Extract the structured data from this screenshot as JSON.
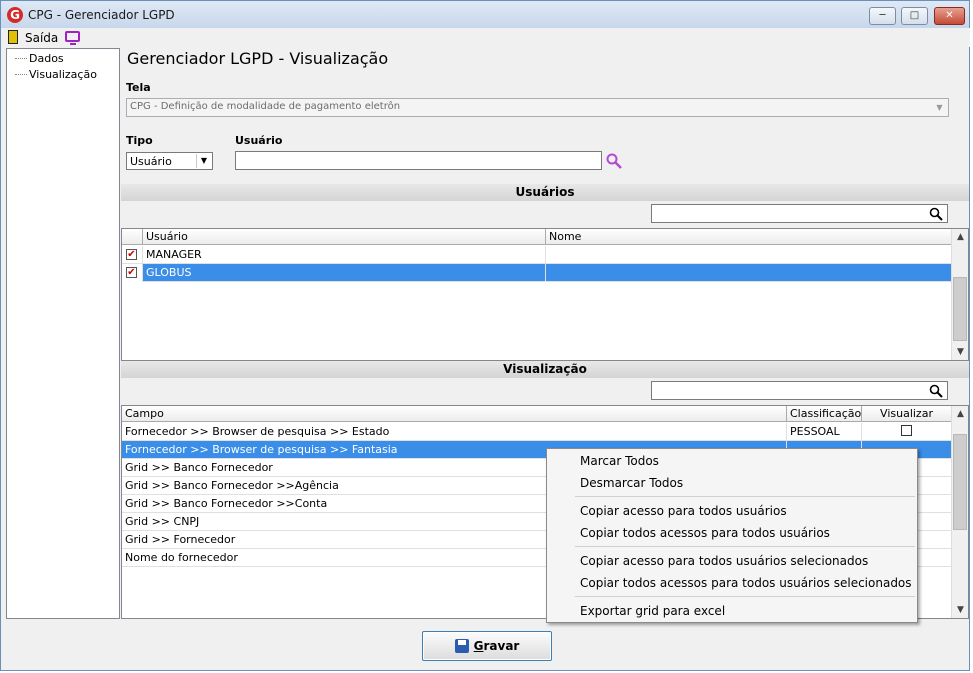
{
  "window": {
    "title": "CPG - Gerenciador LGPD"
  },
  "menubar": {
    "exit_label": "Saída"
  },
  "tree": {
    "items": [
      "Dados",
      "Visualização"
    ]
  },
  "main": {
    "title": "Gerenciador LGPD - Visualização",
    "tela_label": "Tela",
    "tela_value": "CPG - Definição de modalidade de pagamento eletrôn",
    "tipo_label": "Tipo",
    "tipo_value": "Usuário",
    "usuario_label": "Usuário",
    "usuario_value": ""
  },
  "users_section": {
    "title": "Usuários",
    "columns": [
      "Usuário",
      "Nome"
    ],
    "rows": [
      {
        "user": "MANAGER",
        "name": "",
        "checked": true
      },
      {
        "user": "GLOBUS",
        "name": "",
        "checked": true
      }
    ]
  },
  "view_section": {
    "title": "Visualização",
    "columns": [
      "Campo",
      "Classificação",
      "Visualizar"
    ],
    "rows": [
      {
        "campo": "Fornecedor >> Browser de pesquisa >> Estado",
        "classificacao": "PESSOAL",
        "visualizar": false
      },
      {
        "campo": "Fornecedor >> Browser de pesquisa >> Fantasia",
        "classificacao": "",
        "visualizar": false
      },
      {
        "campo": "Grid >> Banco Fornecedor",
        "classificacao": "",
        "visualizar": false
      },
      {
        "campo": "Grid >> Banco Fornecedor >>Agência",
        "classificacao": "",
        "visualizar": false
      },
      {
        "campo": "Grid >> Banco Fornecedor >>Conta",
        "classificacao": "",
        "visualizar": false
      },
      {
        "campo": "Grid >> CNPJ",
        "classificacao": "",
        "visualizar": false
      },
      {
        "campo": "Grid >> Fornecedor",
        "classificacao": "",
        "visualizar": false
      },
      {
        "campo": "Nome do fornecedor",
        "classificacao": "",
        "visualizar": false
      }
    ]
  },
  "context_menu": {
    "items": [
      "Marcar Todos",
      "Desmarcar Todos",
      "Copiar acesso para todos usuários",
      "Copiar todos acessos para todos usuários",
      "Copiar acesso para todos usuários selecionados",
      "Copiar todos acessos para todos usuários selecionados",
      "Exportar grid para excel"
    ]
  },
  "footer": {
    "save_label_underlined": "G",
    "save_label_rest": "ravar"
  }
}
